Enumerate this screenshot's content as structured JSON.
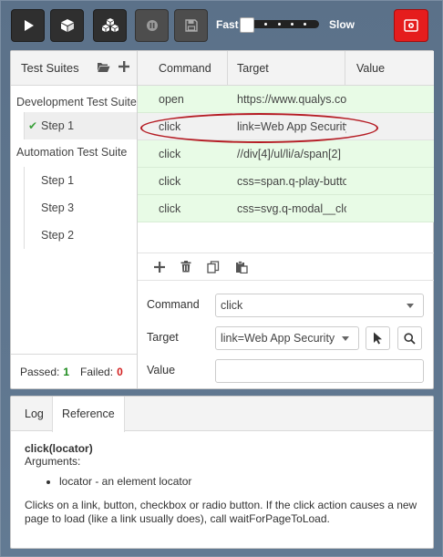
{
  "toolbar": {
    "run_all": "play-icon",
    "run_suite": "cube-icon",
    "run_all_suites": "cubes-icon",
    "pause": "pause-icon",
    "save": "save-icon",
    "speed_fast": "Fast",
    "speed_slow": "Slow",
    "record": "record-icon",
    "speed_level": 0
  },
  "colors": {
    "record": "#e51d1d",
    "passed_row": "#e8fbe6",
    "passed_text": "#1c8a1c",
    "failed_text": "#d32020",
    "annotation": "#b51c24"
  },
  "test_suites": {
    "title": "Test Suites",
    "suites": [
      {
        "name": "Development Test Suite",
        "steps": [
          {
            "label": "Step 1",
            "passed": true
          }
        ]
      },
      {
        "name": "Automation Test Suite",
        "steps": [
          {
            "label": "Step 1"
          },
          {
            "label": "Step 3"
          },
          {
            "label": "Step 2"
          }
        ]
      }
    ],
    "passed_label": "Passed:",
    "passed_count": "1",
    "failed_label": "Failed:",
    "failed_count": "0"
  },
  "commands": {
    "headers": [
      "Command",
      "Target",
      "Value"
    ],
    "rows": [
      {
        "command": "open",
        "target": "https://www.qualys.com",
        "value": ""
      },
      {
        "command": "click",
        "target": "link=Web App Security",
        "value": ""
      },
      {
        "command": "click",
        "target": "//div[4]/ul/li/a/span[2]",
        "value": ""
      },
      {
        "command": "click",
        "target": "css=span.q-play-button",
        "value": ""
      },
      {
        "command": "click",
        "target": "css=svg.q-modal__close",
        "value": ""
      }
    ]
  },
  "editor": {
    "command_label": "Command",
    "command_value": "click",
    "target_label": "Target",
    "target_value": "link=Web App Security",
    "value_label": "Value",
    "value_value": ""
  },
  "bottom": {
    "tabs": [
      "Log",
      "Reference"
    ],
    "active_tab": "Reference",
    "signature": "click(locator)",
    "arguments_label": "Arguments:",
    "arguments": [
      "locator - an element locator"
    ],
    "description": "Clicks on a link, button, checkbox or radio button. If the click action causes a new page to load (like a link usually does), call waitForPageToLoad."
  }
}
